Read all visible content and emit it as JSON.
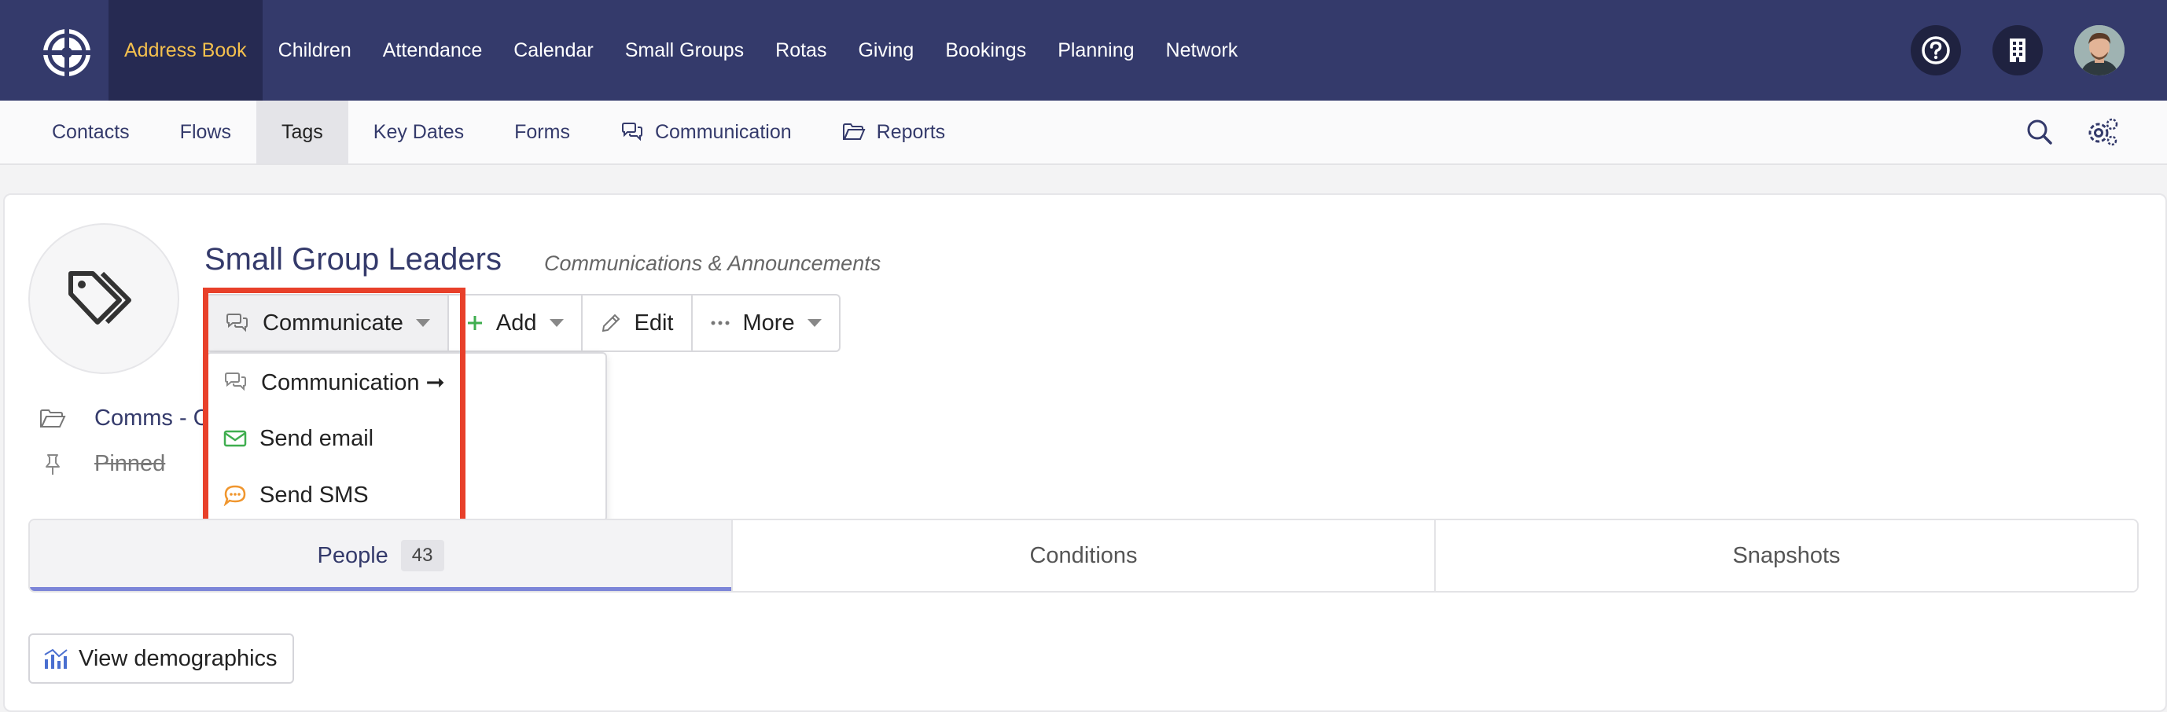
{
  "topnav": {
    "items": [
      {
        "label": "Address Book",
        "active": true
      },
      {
        "label": "Children"
      },
      {
        "label": "Attendance"
      },
      {
        "label": "Calendar"
      },
      {
        "label": "Small Groups"
      },
      {
        "label": "Rotas"
      },
      {
        "label": "Giving"
      },
      {
        "label": "Bookings"
      },
      {
        "label": "Planning"
      },
      {
        "label": "Network"
      }
    ],
    "icons": [
      "help-icon",
      "building-icon",
      "avatar"
    ]
  },
  "subnav": {
    "items": [
      {
        "label": "Contacts"
      },
      {
        "label": "Flows"
      },
      {
        "label": "Tags",
        "active": true
      },
      {
        "label": "Key Dates"
      },
      {
        "label": "Forms"
      },
      {
        "label": "Communication",
        "icon": "chat-icon"
      },
      {
        "label": "Reports",
        "icon": "folder-icon"
      }
    ],
    "icons": [
      "search-icon",
      "settings-icon"
    ]
  },
  "page": {
    "title": "Small Group Leaders",
    "subtitle": "Communications & Announcements"
  },
  "actions": {
    "communicate": "Communicate",
    "add": "Add",
    "edit": "Edit",
    "more": "More"
  },
  "dropdown": {
    "items": [
      {
        "label": "Communication ➞",
        "icon": "chat-icon"
      },
      {
        "label": "Send email",
        "icon": "envelope-icon"
      },
      {
        "label": "Send SMS",
        "icon": "sms-icon"
      }
    ]
  },
  "meta": {
    "folder_link": "Comms - C",
    "pinned_label": "Pinned"
  },
  "tabs": [
    {
      "label": "People",
      "count": "43",
      "active": true
    },
    {
      "label": "Conditions"
    },
    {
      "label": "Snapshots"
    }
  ],
  "demographics": {
    "label": "View demographics"
  },
  "colors": {
    "nav_bg": "#343a6b",
    "nav_active_bg": "#262a52",
    "nav_active_text": "#f4c04e",
    "highlight": "#e8402a",
    "add_green": "#3fae4f",
    "email_green": "#3fae4f",
    "sms_orange": "#f0962e",
    "tab_underline": "#7c85d8"
  }
}
